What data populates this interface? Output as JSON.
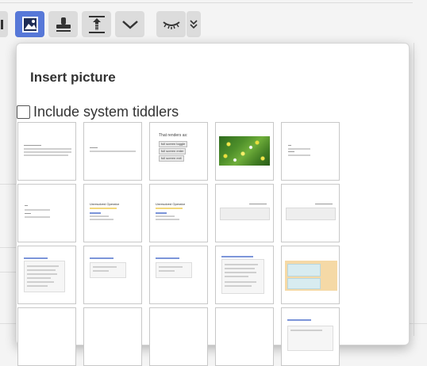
{
  "toolbar": {
    "buttons": [
      {
        "name": "toolbar-edge-button",
        "icon": "separator-icon",
        "active": false
      },
      {
        "name": "insert-picture-button",
        "icon": "picture-icon",
        "active": true
      },
      {
        "name": "stamp-button",
        "icon": "stamp-icon",
        "active": false
      },
      {
        "name": "excise-button",
        "icon": "excise-icon",
        "active": false
      },
      {
        "name": "more-button",
        "icon": "chevron-down-icon",
        "active": false
      },
      {
        "name": "preview-toggle-button",
        "icon": "closed-eye-icon",
        "active": false
      },
      {
        "name": "overflow-button",
        "icon": "double-chevron-down-icon",
        "active": false
      }
    ],
    "active_color": "#5778d8",
    "button_color": "#dcdcdc"
  },
  "popup": {
    "title": "Insert picture",
    "include_system_label": "Include system tiddlers",
    "include_system_checked": false,
    "thumbnails": [
      {
        "kind": "text-lines"
      },
      {
        "kind": "text-lines-single"
      },
      {
        "kind": "fullscreen-buttons",
        "heading": "That renders as:",
        "buttons": [
          "full screen toggle",
          "full screen enter",
          "full screen exit"
        ]
      },
      {
        "kind": "photo"
      },
      {
        "kind": "form-lines"
      },
      {
        "kind": "form-lines-2"
      },
      {
        "kind": "unresolved-a",
        "heading": "Unresolved Operator"
      },
      {
        "kind": "unresolved-b",
        "heading": "Unresolved Operator"
      },
      {
        "kind": "grey-panel"
      },
      {
        "kind": "grey-panel"
      },
      {
        "kind": "toolbar-list"
      },
      {
        "kind": "toolbar-dialog"
      },
      {
        "kind": "toolbar-dialog-2"
      },
      {
        "kind": "toolbar-list-2"
      },
      {
        "kind": "colored-panels"
      },
      {
        "kind": "partial"
      },
      {
        "kind": "partial"
      },
      {
        "kind": "partial"
      },
      {
        "kind": "partial"
      },
      {
        "kind": "partial-dialog"
      }
    ]
  }
}
